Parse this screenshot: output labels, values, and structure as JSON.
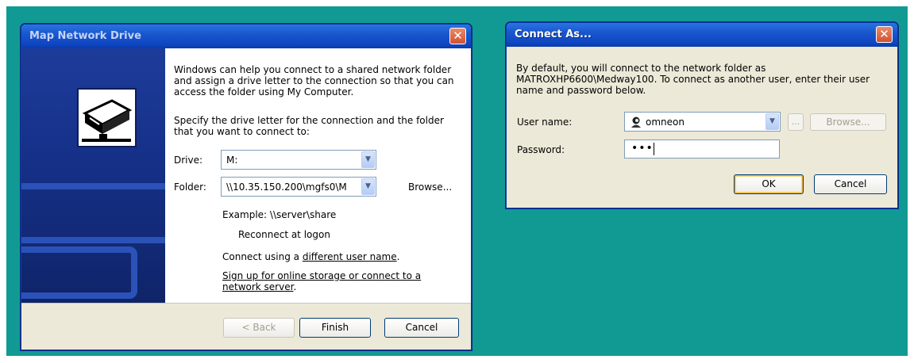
{
  "map_network_drive": {
    "title": "Map Network Drive",
    "intro": "Windows can help you connect to a shared network folder and assign a drive letter to the connection so that you can access the folder using My Computer.",
    "instruction": "Specify the drive letter for the connection and the folder that you want to connect to:",
    "drive_label": "Drive:",
    "drive_value": "M:",
    "folder_label": "Folder:",
    "folder_value": "\\\\10.35.150.200\\mgfs0\\M",
    "browse_label": "Browse...",
    "example": "Example: \\\\server\\share",
    "reconnect_label": "Reconnect at logon",
    "connect_prefix": "Connect using a ",
    "different_user_link": "different user name",
    "connect_suffix": ".",
    "signup_link": "Sign up for online storage or connect to a network server",
    "signup_suffix": ".",
    "back_label": "< Back",
    "finish_label": "Finish",
    "cancel_label": "Cancel"
  },
  "connect_as": {
    "title": "Connect As...",
    "intro": "By default, you will connect to the network folder as MATROXHP6600\\Medway100. To connect as another user, enter their user name and password below.",
    "username_label": "User name:",
    "username_value": "omneon",
    "ellipsis_label": "...",
    "browse_label": "Browse...",
    "password_label": "Password:",
    "password_value": "•••",
    "ok_label": "OK",
    "cancel_label": "Cancel"
  },
  "colors": {
    "desktop": "#119a94",
    "titlebar": "#0e45c0",
    "side_panel": "#16318a"
  }
}
